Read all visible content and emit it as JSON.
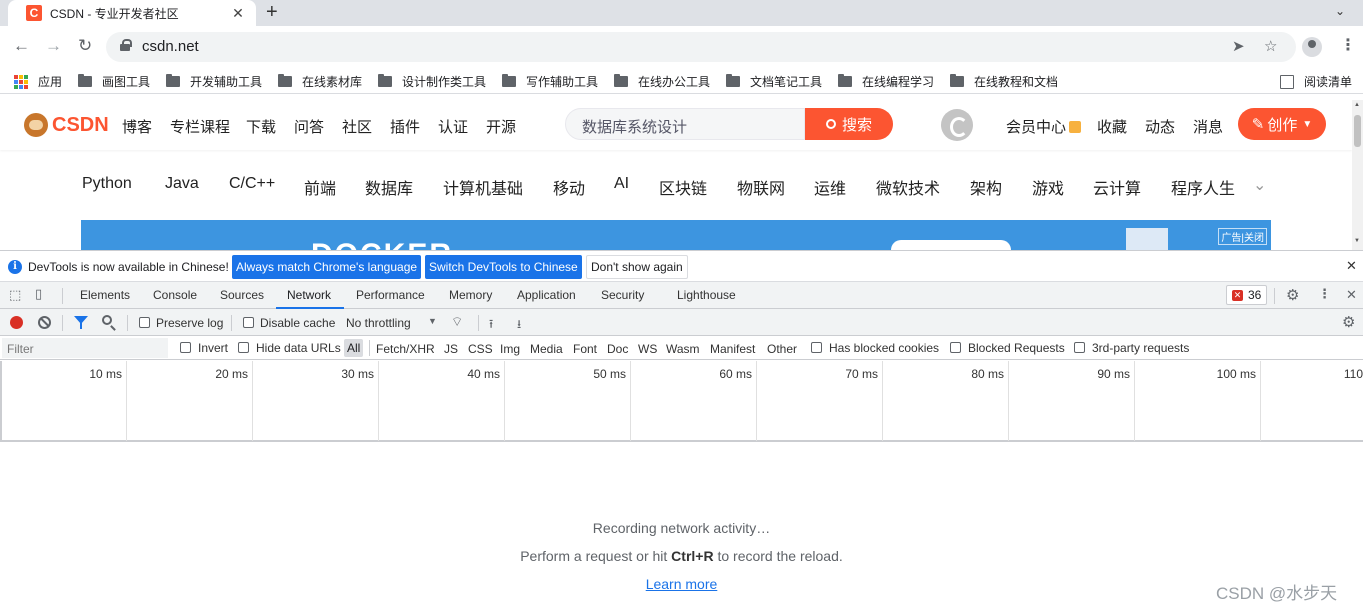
{
  "browser": {
    "tab_title": "CSDN - 专业开发者社区",
    "favicon_letter": "C",
    "url": "csdn.net",
    "bookmarks": [
      "应用",
      "画图工具",
      "开发辅助工具",
      "在线素材库",
      "设计制作类工具",
      "写作辅助工具",
      "在线办公工具",
      "文档笔记工具",
      "在线编程学习",
      "在线教程和文档"
    ],
    "reading_list": "阅读清单"
  },
  "csdn": {
    "logo_text": "CSDN",
    "nav": [
      "博客",
      "专栏课程",
      "下载",
      "问答",
      "社区",
      "插件",
      "认证",
      "开源"
    ],
    "search_placeholder": "数据库系统设计",
    "search_button": "搜索",
    "user_links": [
      "会员中心",
      "收藏",
      "动态",
      "消息"
    ],
    "create_button": "创作",
    "categories": [
      "Python",
      "Java",
      "C/C++",
      "前端",
      "数据库",
      "计算机基础",
      "移动",
      "AI",
      "区块链",
      "物联网",
      "运维",
      "微软技术",
      "架构",
      "游戏",
      "云计算",
      "程序人生"
    ],
    "banner_ad_label": "广告|关闭",
    "brand_color": "#fc5531"
  },
  "devtools": {
    "infobar_text": "DevTools is now available in Chinese!",
    "infobar_buttons": [
      "Always match Chrome's language",
      "Switch DevTools to Chinese",
      "Don't show again"
    ],
    "tabs": [
      "Elements",
      "Console",
      "Sources",
      "Network",
      "Performance",
      "Memory",
      "Application",
      "Security",
      "Lighthouse"
    ],
    "active_tab": "Network",
    "error_count": "36",
    "preserve_log": "Preserve log",
    "disable_cache": "Disable cache",
    "throttling": "No throttling",
    "filter_placeholder": "Filter",
    "invert": "Invert",
    "hide_data_urls": "Hide data URLs",
    "resource_types": [
      "All",
      "Fetch/XHR",
      "JS",
      "CSS",
      "Img",
      "Media",
      "Font",
      "Doc",
      "WS",
      "Wasm",
      "Manifest",
      "Other"
    ],
    "has_blocked_cookies": "Has blocked cookies",
    "blocked_requests": "Blocked Requests",
    "third_party": "3rd-party requests",
    "timeline_ticks": [
      "10 ms",
      "20 ms",
      "30 ms",
      "40 ms",
      "50 ms",
      "60 ms",
      "70 ms",
      "80 ms",
      "90 ms",
      "100 ms",
      "110"
    ],
    "recording": "Recording network activity…",
    "hint_before": "Perform a request or hit ",
    "hint_shortcut": "Ctrl+R",
    "hint_after": " to record the reload.",
    "learn_more": "Learn more"
  },
  "watermark": "CSDN @水步天"
}
